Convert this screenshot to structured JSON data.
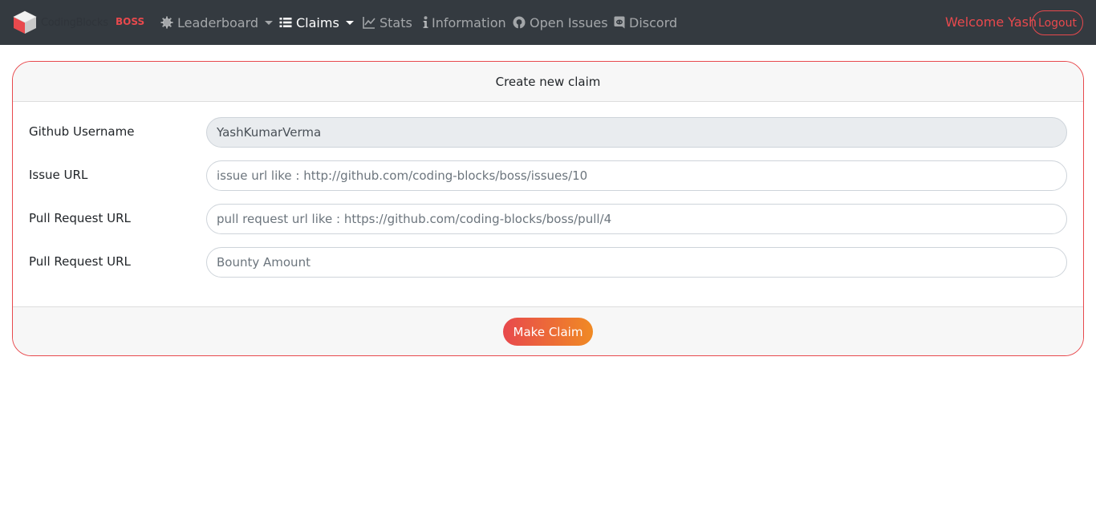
{
  "brand": {
    "text": "CodingBlocks",
    "badge": "BOSS"
  },
  "nav": {
    "leaderboard": "Leaderboard",
    "claims": "Claims",
    "stats": "Stats",
    "information": "Information",
    "open_issues": "Open Issues",
    "discord": "Discord"
  },
  "user": {
    "welcome": "Welcome Yash",
    "logout": "Logout"
  },
  "form": {
    "title": "Create new claim",
    "github_label": "Github Username",
    "github_value": "YashKumarVerma",
    "issue_label": "Issue URL",
    "issue_placeholder": "issue url like : http://github.com/coding-blocks/boss/issues/10",
    "pr_label": "Pull Request URL",
    "pr_placeholder": "pull request url like : https://github.com/coding-blocks/boss/pull/4",
    "bounty_label": "Pull Request URL",
    "bounty_placeholder": "Bounty Amount",
    "submit": "Make Claim"
  },
  "colors": {
    "navbar": "#343a40",
    "accent": "#e8494d",
    "gradient_end": "#f08a24"
  },
  "icons": [
    "cube-logo-icon",
    "gear-icon",
    "list-icon",
    "line-chart-icon",
    "info-icon",
    "github-icon",
    "discord-icon",
    "caret-down-icon"
  ]
}
